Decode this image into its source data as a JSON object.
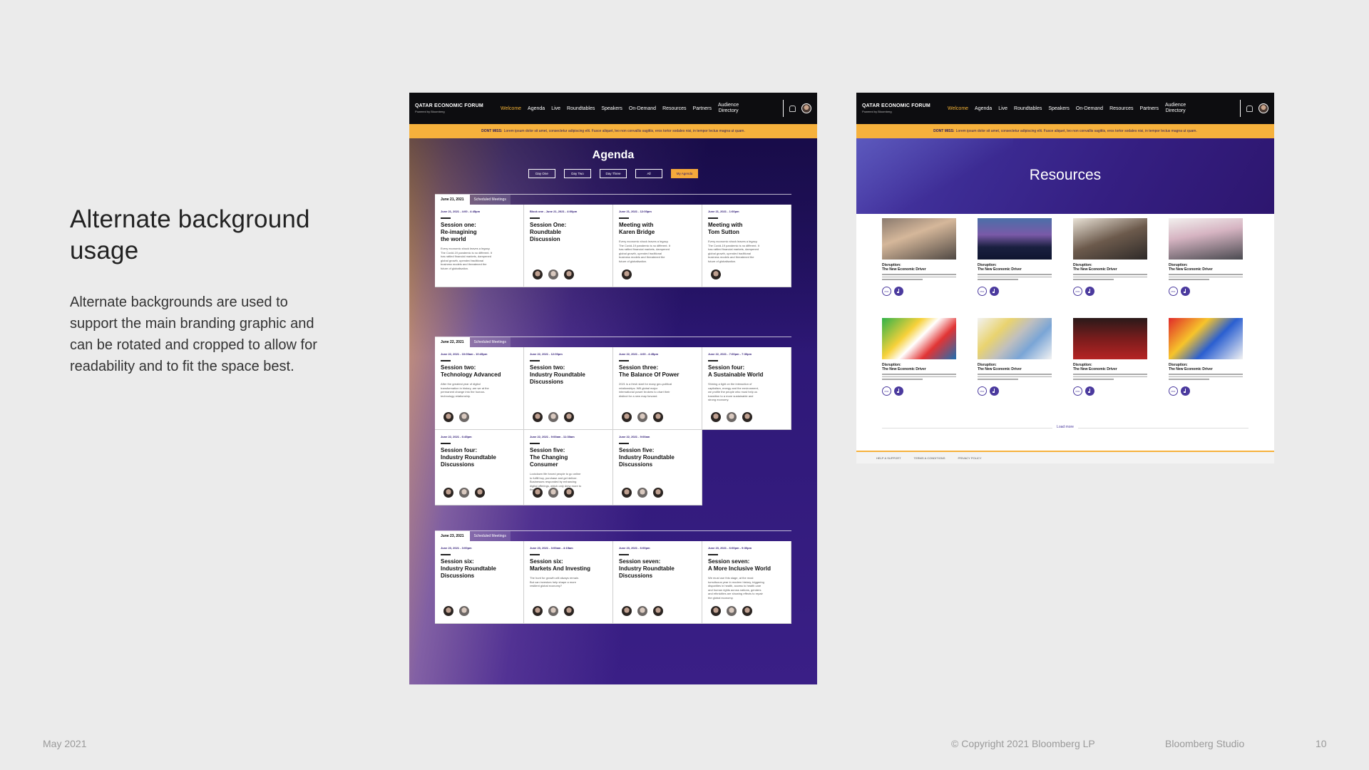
{
  "slide": {
    "title": "Alternate background usage",
    "body": "Alternate backgrounds are used to support the main branding graphic and can be rotated and cropped to allow for readability and to fit the space best.",
    "footer_date": "May 2021",
    "copyright": "© Copyright 2021 Bloomberg LP",
    "studio": "Bloomberg Studio",
    "page_number": "10"
  },
  "site": {
    "brand": "QATAR ECONOMIC FORUM",
    "brand_sub": "Powered by Bloomberg",
    "nav": [
      "Welcome",
      "Agenda",
      "Live",
      "Roundtables",
      "Speakers",
      "On-Demand",
      "Resources",
      "Partners"
    ],
    "nav_audience_1": "Audience",
    "nav_audience_2": "Directory",
    "banner_bold": "DONT MISS:",
    "banner_text": "Lorem ipsum dolor sit amet, consectetur adipiscing elit. Fusce aliquet, leo non convallis sagittis, eros tortor sodales nisi, in tempor lectus magna ut quam."
  },
  "agenda": {
    "heading": "Agenda",
    "tabs": [
      "Day One",
      "Day Two",
      "Day Three",
      "All",
      "My Agenda"
    ],
    "scheduled_label": "Scheduled Meetings",
    "days": [
      {
        "date": "June 21, 2021",
        "cards": [
          {
            "time": "June 21, 2021 - 4:00 - 4:45pm",
            "title": "Session one:\nRe-imagining\nthe world",
            "desc": "Every economic shock leaves a legacy.\nThe Covid-19 pandemic is no different. It\nhas rattled financial markets, dampened\nglobal growth, upended traditional\nbusiness models and threatened the\nfuture of globalisation.",
            "people": 0
          },
          {
            "time": "Block one - June 21, 2021 - 4:00pm",
            "title": "Session One:\nRoundtable\nDiscussion",
            "desc": "",
            "people": 3
          },
          {
            "time": "June 21, 2021 - 12:00pm",
            "title": "Meeting with\nKaren Bridge",
            "desc": "Every economic shock leaves a legacy.\nThe Covid-19 pandemic is no different. It\nhas rattled financial markets, dampened\nglobal growth, upended traditional\nbusiness models and threatened the\nfuture of globalisation.",
            "people": 1
          },
          {
            "time": "June 21, 2021 - 1:00pm",
            "title": "Meeting with\nTom Sutton",
            "desc": "Every economic shock leaves a legacy.\nThe Covid-19 pandemic is no different. It\nhas rattled financial markets, dampened\nglobal growth, upended traditional\nbusiness models and threatened the\nfuture of globalisation.",
            "people": 1
          }
        ]
      },
      {
        "date": "June 22, 2021",
        "cards": [
          {
            "time": "June 22, 2021 - 10:00am - 10:45pm",
            "title": "Session two:\nTechnology Advanced",
            "desc": "After the greatest year of digital\ntransformation in history, are we at the\npermanent change into the human-\ntechnology relationship.",
            "people": 2
          },
          {
            "time": "June 22, 2021 - 12:00pm",
            "title": "Session two:\nIndustry Roundtable\nDiscussions",
            "desc": "",
            "people": 3
          },
          {
            "time": "June 22, 2021 - 4:00 - 4:45pm",
            "title": "Session three:\nThe Balance Of Power",
            "desc": "2021 is a fresh start for many geo-political\nrelationships. Will global major\ninternational power brokers to chart their\ndistinct for a new map forward.",
            "people": 3
          },
          {
            "time": "June 22, 2021 - 7:00pm - 7:30pm",
            "title": "Session four:\nA Sustainable World",
            "desc": "Shining a light on the interaction of\ncapitalism, energy and the environment,\nwe profile the people who must help us\ntransition to a more sustainable and\nstrong economy.",
            "people": 3
          },
          {
            "time": "June 22, 2021 - 6:45pm",
            "title": "Session four:\nIndustry Roundtable\nDiscussions",
            "desc": "",
            "people": 3
          },
          {
            "time": "June 22, 2021 - 9:00am - 11:30am",
            "title": "Session five:\nThe Changing\nConsumer",
            "desc": "Lockdown life forced people to go online\nto fulfill buy, purchase and get deliver.\nBusinesses responded by enhancing\ndigital offerings, which only drew more to\nthe web.",
            "people": 3
          },
          {
            "time": "June 22, 2021 - 9:00am",
            "title": "Session five:\nIndustry Roundtable\nDiscussions",
            "desc": "",
            "people": 3
          }
        ]
      },
      {
        "date": "June 23, 2021",
        "cards": [
          {
            "time": "June 23, 2021 - 3:00pm",
            "title": "Session six:\nIndustry Roundtable\nDiscussions",
            "desc": "",
            "people": 2
          },
          {
            "time": "June 23, 2021 - 3:00am - 4:15am",
            "title": "Session six:\nMarkets And Investing",
            "desc": "The hunt for growth will always remain.\nBut can investors help shape a more\nresilient global economy?",
            "people": 3
          },
          {
            "time": "June 23, 2021 - 6:00pm",
            "title": "Session seven:\nIndustry Roundtable\nDiscussions",
            "desc": "",
            "people": 3
          },
          {
            "time": "June 23, 2021 - 6:00pm - 9:30pm",
            "title": "Session seven:\nA More Inclusive World",
            "desc": "We must use this stage, at the most\ntumultuous year in modern history, triggering\ndisparities in health, access to health care\nand human rights across nations, genders\nand ethnicities are showing effects to repair\nthe global economy.",
            "people": 3
          }
        ]
      }
    ]
  },
  "resources": {
    "heading": "Resources",
    "item_label": "Disruption:\nThe New Economic Driver",
    "pdf_label": "PDF",
    "load_more": "Load more",
    "footer_links": [
      "HELP & SUPPORT",
      "TERMS & CONDITIONS",
      "PRIVACY POLICY"
    ],
    "thumbs": [
      "linear-gradient(160deg,#8a7a6e 0%,#d5b79a 40%,#4f4843 100%)",
      "linear-gradient(180deg,#4b6fa8 0%,#7a5aa8 40%,#1a2040 70%,#0e1530 100%)",
      "linear-gradient(160deg,#e9e2d6 0%,#6c5a4c 50%,#2e2a28 100%)",
      "linear-gradient(170deg,#f2f0ee 0%,#d6b4c2 40%,#4a4a50 100%)",
      "linear-gradient(135deg,#2fb24a 0%,#f7d13a 35%,#ffffff 50%,#e23434 70%,#1c6fb2 100%)",
      "linear-gradient(135deg,#f2f2f2 0%,#e9d36f 30%,#bfbfbf 50%,#7aa5d6 70%,#f2f2f2 100%)",
      "linear-gradient(180deg,#2a1a1a 0%,#7a1c1c 50%,#b52424 100%)",
      "linear-gradient(135deg,#e02a2a 0%,#f6c42b 35%,#2a5fd1 60%,#f2f2f2 100%)"
    ]
  }
}
